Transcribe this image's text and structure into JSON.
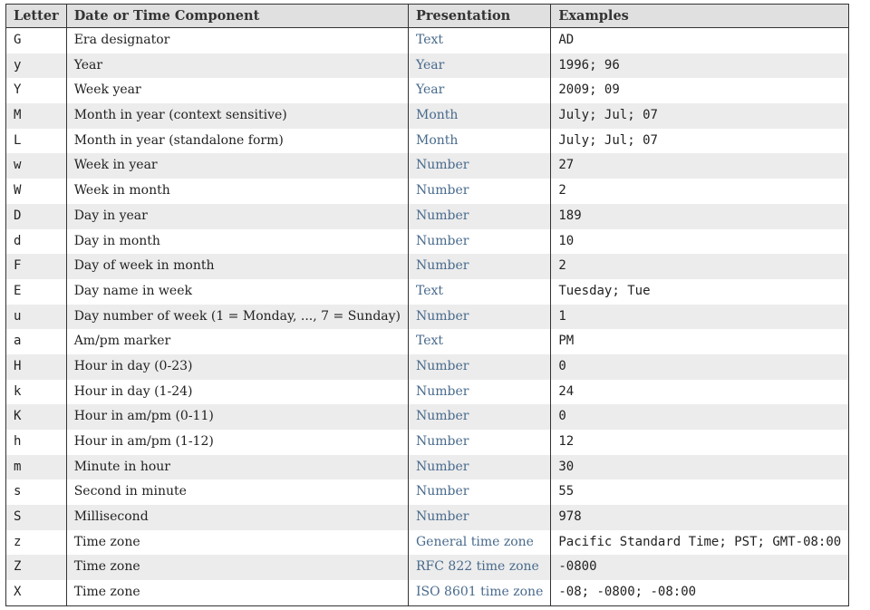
{
  "headers": {
    "letter": "Letter",
    "component": "Date or Time Component",
    "presentation": "Presentation",
    "examples": "Examples"
  },
  "rows": [
    {
      "letter": "G",
      "component": "Era designator",
      "presentation": "Text",
      "examples": "AD"
    },
    {
      "letter": "y",
      "component": "Year",
      "presentation": "Year",
      "examples": "1996; 96"
    },
    {
      "letter": "Y",
      "component": "Week year",
      "presentation": "Year",
      "examples": "2009; 09"
    },
    {
      "letter": "M",
      "component": "Month in year (context sensitive)",
      "presentation": "Month",
      "examples": "July; Jul; 07"
    },
    {
      "letter": "L",
      "component": "Month in year (standalone form)",
      "presentation": "Month",
      "examples": "July; Jul; 07"
    },
    {
      "letter": "w",
      "component": "Week in year",
      "presentation": "Number",
      "examples": "27"
    },
    {
      "letter": "W",
      "component": "Week in month",
      "presentation": "Number",
      "examples": "2"
    },
    {
      "letter": "D",
      "component": "Day in year",
      "presentation": "Number",
      "examples": "189"
    },
    {
      "letter": "d",
      "component": "Day in month",
      "presentation": "Number",
      "examples": "10"
    },
    {
      "letter": "F",
      "component": "Day of week in month",
      "presentation": "Number",
      "examples": "2"
    },
    {
      "letter": "E",
      "component": "Day name in week",
      "presentation": "Text",
      "examples": "Tuesday; Tue"
    },
    {
      "letter": "u",
      "component": "Day number of week (1 = Monday, ..., 7 = Sunday)",
      "presentation": "Number",
      "examples": "1"
    },
    {
      "letter": "a",
      "component": "Am/pm marker",
      "presentation": "Text",
      "examples": "PM"
    },
    {
      "letter": "H",
      "component": "Hour in day (0-23)",
      "presentation": "Number",
      "examples": "0"
    },
    {
      "letter": "k",
      "component": "Hour in day (1-24)",
      "presentation": "Number",
      "examples": "24"
    },
    {
      "letter": "K",
      "component": "Hour in am/pm (0-11)",
      "presentation": "Number",
      "examples": "0"
    },
    {
      "letter": "h",
      "component": "Hour in am/pm (1-12)",
      "presentation": "Number",
      "examples": "12"
    },
    {
      "letter": "m",
      "component": "Minute in hour",
      "presentation": "Number",
      "examples": "30"
    },
    {
      "letter": "s",
      "component": "Second in minute",
      "presentation": "Number",
      "examples": "55"
    },
    {
      "letter": "S",
      "component": "Millisecond",
      "presentation": "Number",
      "examples": "978"
    },
    {
      "letter": "z",
      "component": "Time zone",
      "presentation": "General time zone",
      "examples": "Pacific Standard Time; PST; GMT-08:00"
    },
    {
      "letter": "Z",
      "component": "Time zone",
      "presentation": "RFC 822 time zone",
      "examples": "-0800"
    },
    {
      "letter": "X",
      "component": "Time zone",
      "presentation": "ISO 8601 time zone",
      "examples": "-08; -0800; -08:00"
    }
  ]
}
